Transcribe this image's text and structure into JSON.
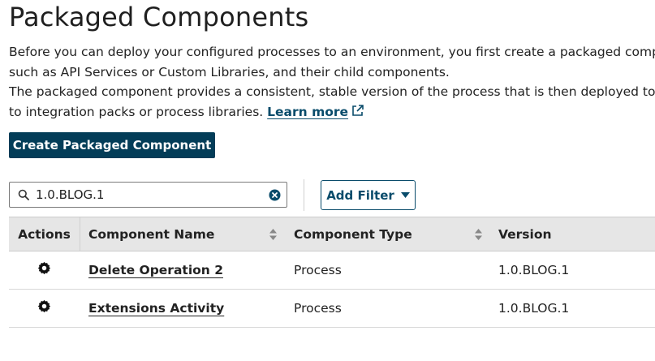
{
  "page": {
    "title": "Packaged Components",
    "description_lines": [
      "Before you can deploy your configured processes to an environment, you first create a packaged compon",
      "such as API Services or Custom Libraries, and their child components.",
      "The packaged component provides a consistent, stable version of the process that is then deployed to env",
      "to integration packs or process libraries."
    ],
    "learn_more": "Learn more"
  },
  "toolbar": {
    "create_label": "Create Packaged Component",
    "search_value": "1.0.BLOG.1",
    "add_filter_label": "Add Filter"
  },
  "table": {
    "headers": {
      "actions": "Actions",
      "name": "Component Name",
      "type": "Component Type",
      "version": "Version"
    },
    "rows": [
      {
        "name": "Delete Operation 2",
        "type": "Process",
        "version": "1.0.BLOG.1"
      },
      {
        "name": "Extensions Activity",
        "type": "Process",
        "version": "1.0.BLOG.1"
      }
    ]
  },
  "icons": {
    "external_link": "external-link-icon",
    "search": "search-icon",
    "clear": "clear-icon",
    "filter_caret": "caret-down-icon",
    "sort": "sort-icon",
    "row_actions": "gear-icon"
  },
  "colors": {
    "primary": "#033d58",
    "link": "#0a4c6b",
    "header_bg": "#e6e6e6"
  }
}
